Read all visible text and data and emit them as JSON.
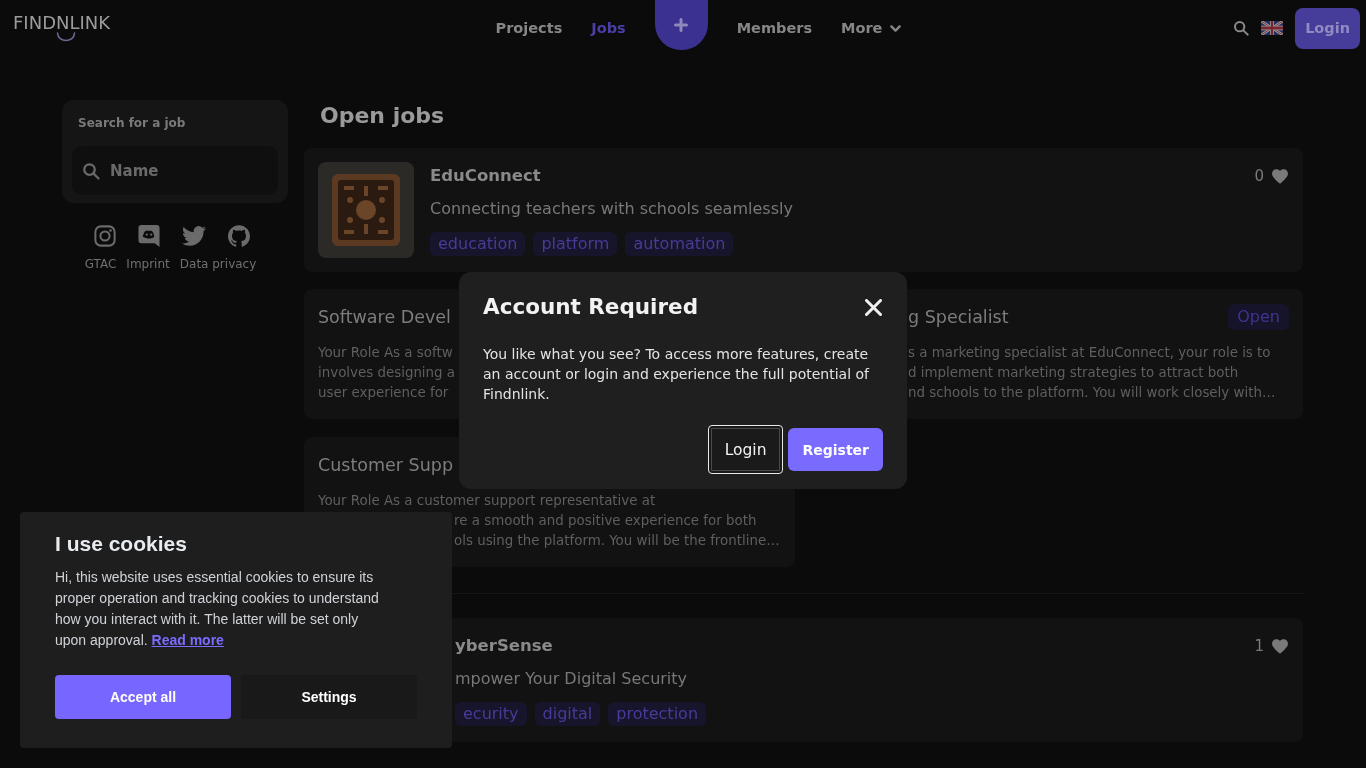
{
  "header": {
    "logo": "FINDNLINK",
    "nav": [
      {
        "kind": "link",
        "label": "Projects",
        "selected": false
      },
      {
        "kind": "link",
        "label": "Jobs",
        "selected": true
      },
      {
        "kind": "add",
        "selected": false
      },
      {
        "kind": "link",
        "label": "Members",
        "selected": false
      },
      {
        "kind": "dropdown",
        "label": "More",
        "selected": false
      }
    ],
    "login": "Login"
  },
  "sidebar": {
    "search": {
      "label": "Search for a job",
      "placeholder": "Name"
    },
    "links": [
      "GTAC",
      "Imprint",
      "Data privacy"
    ]
  },
  "main": {
    "title": "Open jobs",
    "sections": [
      {
        "project": {
          "thumbnail_shown": true,
          "name": "EduConnect",
          "likes": "0",
          "tagline": "Connecting teachers with schools seamlessly",
          "tags": [
            "education",
            "platform",
            "automation"
          ]
        },
        "jobs": [
          {
            "title": "Software Devel",
            "description": [
              "Your Role As a softw",
              "involves designing a",
              "user experience for"
            ]
          },
          {
            "title": "g Specialist",
            "status": "Open",
            "description": [
              "s a marketing specialist at EduConnect, your role is to",
              "d implement marketing strategies to attract both",
              "nd schools to the platform. You will work closely with…"
            ]
          },
          {
            "title": "Customer Supp",
            "description": [
              "Your Role As a customer support representative at",
              "re a smooth and positive experience for both",
              "ols using the platform. You will be the frontline…"
            ]
          }
        ]
      },
      {
        "project": {
          "thumbnail_shown": false,
          "name": "yberSense",
          "likes": "1",
          "tagline": "mpower Your Digital Security",
          "tags": [
            "ecurity",
            "digital",
            "protection"
          ]
        }
      }
    ]
  },
  "modal": {
    "title": "Account Required",
    "text": "You like what you see? To access more features, create an account or login and experience the full potential of Findnlink.",
    "buttons": [
      {
        "kind": "login",
        "label": "Login"
      },
      {
        "kind": "register",
        "label": "Register"
      }
    ]
  },
  "cookie_banner": {
    "title": "I use cookies",
    "text": "Hi, this website uses essential cookies to ensure its proper operation and tracking cookies to understand how you interact with it. The latter will be set only upon approval.",
    "link": "Read more",
    "buttons": [
      {
        "kind": "accept",
        "label": "Accept all"
      },
      {
        "kind": "settings",
        "label": "Settings"
      }
    ]
  }
}
